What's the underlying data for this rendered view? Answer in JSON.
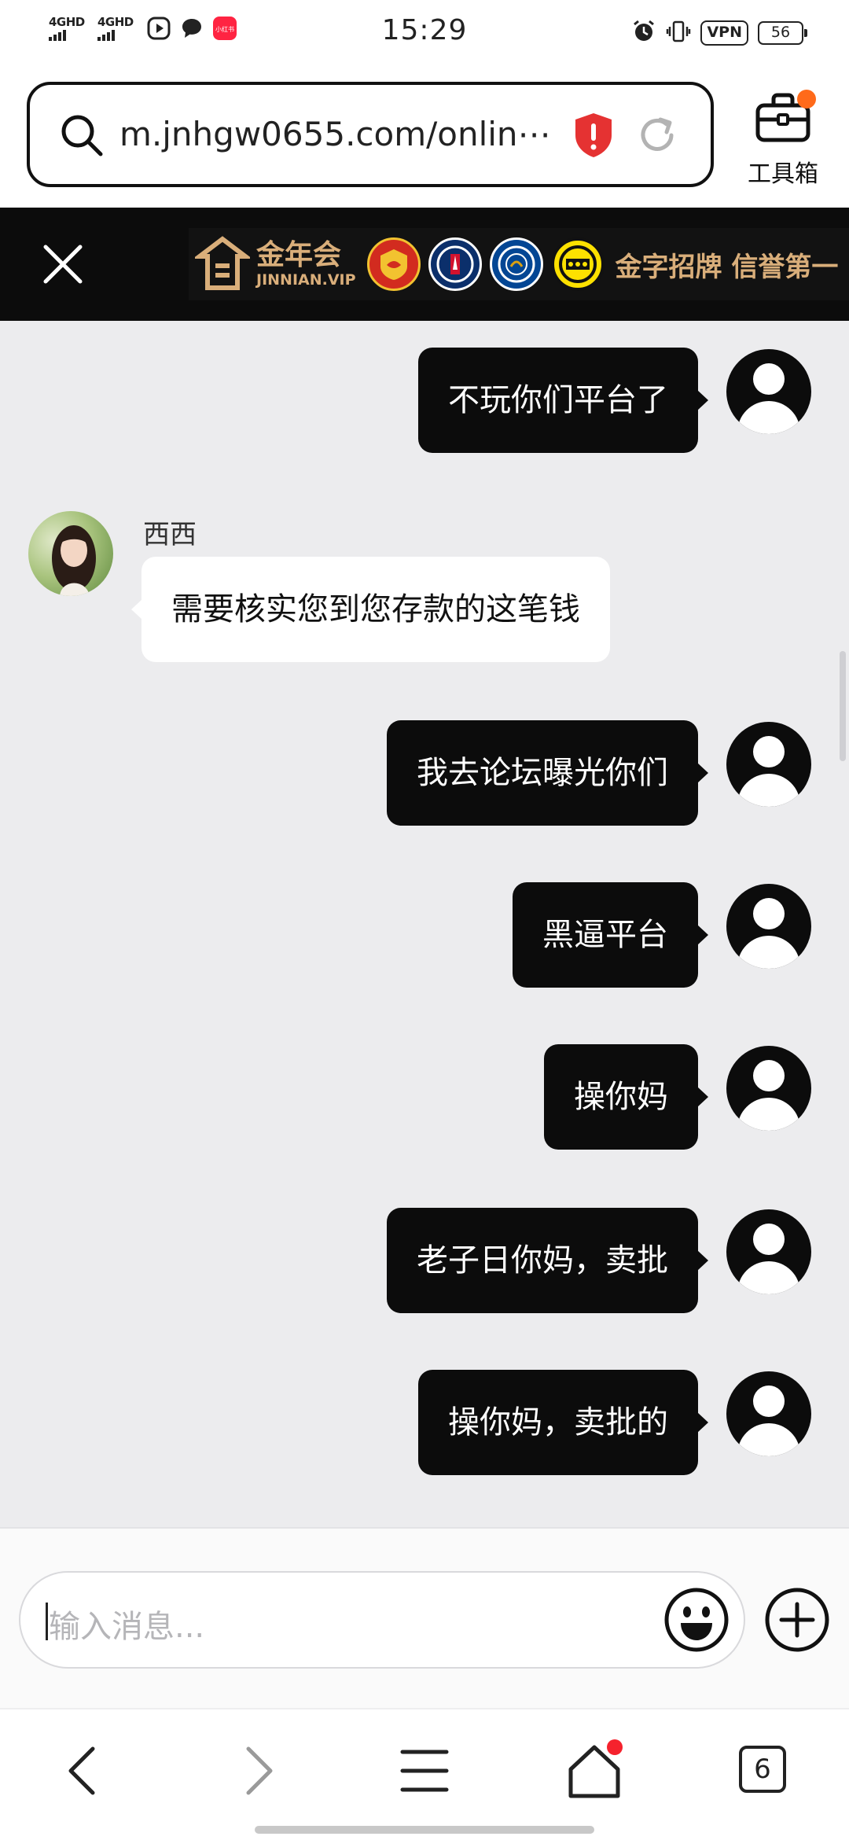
{
  "status_bar": {
    "time": "15:29",
    "networks": [
      "4GHD",
      "4GHD"
    ],
    "vpn": "VPN",
    "battery": "56",
    "red_app_label": "小红书"
  },
  "browser": {
    "url": "m.jnhgw0655.com/onlin⋯",
    "toolbox_label": "工具箱",
    "accent": "#ff6a1a"
  },
  "ad": {
    "brand_cn": "金年会",
    "brand_en": "JINNIAN.VIP",
    "clubs": [
      "MAN UTD",
      "PARIS",
      "CHELSEA",
      "BVB"
    ],
    "slogan": "金字招牌 信誉第一",
    "gold": "#d9ae7a"
  },
  "chat": {
    "agent_name": "西西",
    "messages": [
      {
        "from": "me",
        "text": "不玩你们平台了"
      },
      {
        "from": "agent",
        "text": "需要核实您到您存款的这笔钱"
      },
      {
        "from": "me",
        "text": "我去论坛曝光你们"
      },
      {
        "from": "me",
        "text": "黑逼平台"
      },
      {
        "from": "me",
        "text": "操你妈"
      },
      {
        "from": "me",
        "text": "老子日你妈，卖批"
      },
      {
        "from": "me",
        "text": "操你妈，卖批的"
      }
    ]
  },
  "input": {
    "placeholder": "输入消息..."
  },
  "bottom_nav": {
    "tabs_count": "6",
    "icons": [
      "back-icon",
      "forward-icon",
      "menu-icon",
      "home-icon",
      "tabs-icon"
    ]
  }
}
